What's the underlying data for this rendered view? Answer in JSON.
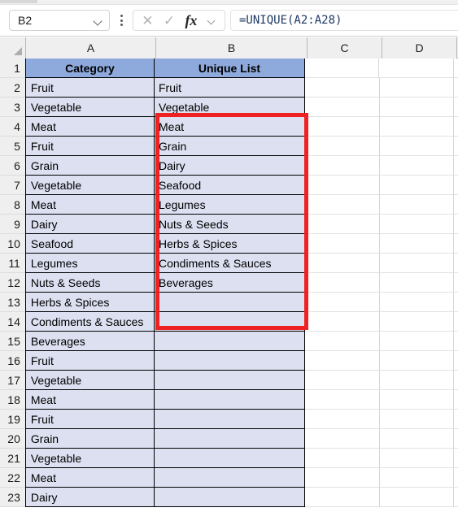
{
  "app": {
    "type": "spreadsheet"
  },
  "formula_bar": {
    "name_box_value": "B2",
    "name_box_dropdown_icon": "chevron-down-icon",
    "kebab_icon": "more-options-icon",
    "cancel_icon": "✕",
    "enter_icon": "✓",
    "fx_label": "fx",
    "fx_dropdown_icon": "chevron-down-icon",
    "formula": "=UNIQUE(A2:A28)"
  },
  "grid": {
    "corner_icon": "select-all-icon",
    "column_headers": [
      "A",
      "B",
      "C",
      "D"
    ],
    "row_numbers": [
      1,
      2,
      3,
      4,
      5,
      6,
      7,
      8,
      9,
      10,
      11,
      12,
      13,
      14,
      15,
      16,
      17,
      18,
      19,
      20,
      21,
      22,
      23
    ],
    "headers": {
      "A1": "Category",
      "B1": "Unique List"
    },
    "column_a": [
      "Fruit",
      "Vegetable",
      "Meat",
      "Fruit",
      "Grain",
      "Vegetable",
      "Meat",
      "Dairy",
      "Seafood",
      "Legumes",
      "Nuts & Seeds",
      "Herbs & Spices",
      "Condiments & Sauces",
      "Beverages",
      "Fruit",
      "Vegetable",
      "Meat",
      "Fruit",
      "Grain",
      "Vegetable",
      "Meat",
      "Dairy"
    ],
    "column_b": [
      "Fruit",
      "Vegetable",
      "Meat",
      "Grain",
      "Dairy",
      "Seafood",
      "Legumes",
      "Nuts & Seeds",
      "Herbs & Spices",
      "Condiments & Sauces",
      "Beverages",
      "",
      "",
      "",
      "",
      "",
      "",
      "",
      "",
      "",
      "",
      ""
    ]
  },
  "annotation": {
    "highlight_color": "#ee2222",
    "highlight_target": "B2:B12"
  },
  "colors": {
    "header_fill": "#8ea9db",
    "cell_fill": "#dce0f0",
    "formula_text": "#1f3864",
    "row_header_bg": "#efefef"
  }
}
